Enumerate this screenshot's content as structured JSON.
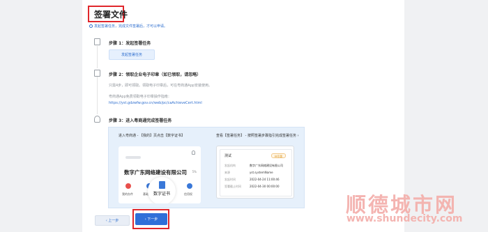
{
  "page": {
    "title": "签署文件",
    "hint": "发起签署任务，完成文件签署后，才可以申请。"
  },
  "steps": [
    {
      "title": "步骤 1：发起签署任务",
      "button_label": "发起签署任务"
    },
    {
      "title": "步骤 2：领取企业电子印章（如已领取，请忽略）",
      "desc": "只需4步，即可领取。领取电子印章后，可在粤商通App安装使用。",
      "guide_label": "粤商通App免费领取电子印章操作指南：",
      "guide_link": "https://yst.gdzwfw.gov.cn/web/pc/caAchieveCert.html"
    },
    {
      "title": "步骤 3：进入粤商通完成签署任务"
    }
  ],
  "panel": {
    "left_instruction": "进入粤商通 - 【我的】页点击【数字证书】",
    "right_instruction": "查看【签署任务】 - 按照签署步骤指引完成签署任务 ›",
    "app": {
      "company": "数字广东网络建设有限公司",
      "tag": "5%",
      "icons": [
        "我的办件",
        "基础资料",
        "数字证书",
        "信用权"
      ],
      "highlight": "数字证书",
      "icon_colors": [
        "#e8504c",
        "#3a78d8",
        "#3a78d8",
        "#3a78d8"
      ]
    },
    "doc": {
      "title": "测试",
      "status": "待签署",
      "rows": [
        {
          "key": "发起机构",
          "value": "数字广东网络建设有限公司"
        },
        {
          "key": "来源",
          "value": "yst.systemName"
        },
        {
          "key": "发起时间",
          "value": "2022-04-24 11:00:46"
        },
        {
          "key": "签署截止时间",
          "value": "2022-04-30 00:00:00"
        }
      ]
    }
  },
  "footer": {
    "prev_label": "‹ 上一步",
    "next_label": "› 下一步"
  },
  "watermark": {
    "text": "顺德城市网",
    "url": "www.shundecity.com"
  },
  "colors": {
    "accent": "#2f6fd8",
    "highlight_border": "#e0262b",
    "panel_bg": "#e6f0fb"
  }
}
